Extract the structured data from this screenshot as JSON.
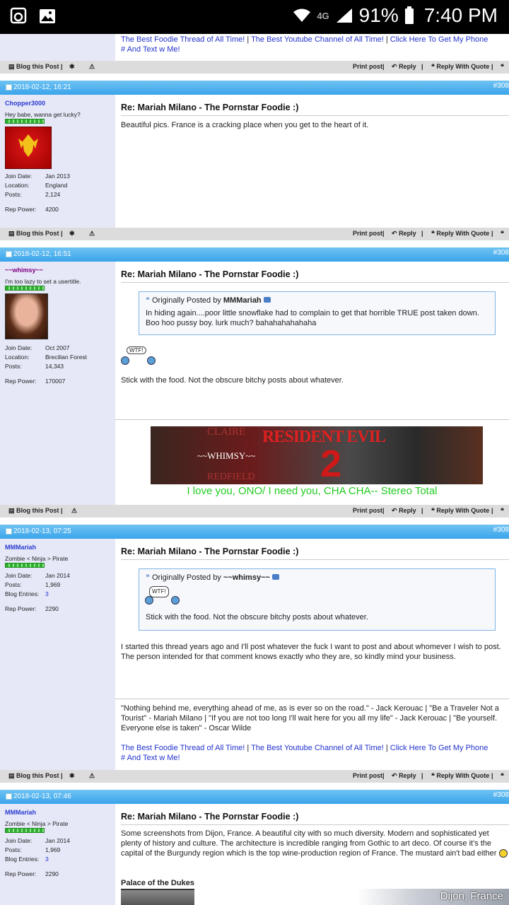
{
  "status_bar": {
    "time": "7:40 PM",
    "battery": "91%",
    "network": "4G"
  },
  "links": {
    "a": "The Best Foodie Thread of All Time!",
    "b": "The Best Youtube Channel of All Time!",
    "c": "Click Here To Get My Phone",
    "d": "# And Text w Me!",
    "sep": "|"
  },
  "controls": {
    "blog": "Blog this Post",
    "print": "Print post",
    "reply": "Reply",
    "reply_quote": "Reply With Quote",
    "sep": "|"
  },
  "post_title": "Re: Mariah Milano - The Pornstar Foodie :)",
  "labels": {
    "join": "Join Date:",
    "location": "Location:",
    "posts": "Posts:",
    "blog_entries": "Blog Entries:",
    "rep_power": "Rep Power:",
    "originally": "Originally Posted by"
  },
  "posts": [
    {
      "date": "2018-02-12, 16:21",
      "num": "#308",
      "user": "Chopper3000",
      "status": "Hey babe, wanna get lucky?",
      "join": "Jan 2013",
      "location": "England",
      "posts": "2,124",
      "rep": "4200",
      "text": "Beautiful pics. France is a cracking place when you get to the heart of it."
    },
    {
      "date": "2018-02-12, 16:51",
      "num": "#308",
      "user": "~~whimsy~~",
      "status": "I'm too lazy to set a usertitle.",
      "join": "Oct 2007",
      "location": "Brecilian Forest",
      "posts": "14,343",
      "rep": "170007",
      "quote_author": "MMMariah",
      "quote_text": "In hiding again....poor little snowflake had to complain to get that horrible TRUE post taken down. Boo hoo pussy boy. lurk much? bahahahahahaha",
      "wtf": "WTF!",
      "text": "Stick with the food. Not the obscure bitchy posts about whatever.",
      "banner_left_top": "CLAIRE",
      "banner_name": "~~WHIMSY~~",
      "banner_left_bottom": "REDFIELD",
      "banner_title": "RESIDENT EVIL",
      "banner_num": "2",
      "sig": "I love you, ONO/ I need you, CHA CHA-- Stereo Total"
    },
    {
      "date": "2018-02-13, 07:25",
      "num": "#308",
      "user": "MMMariah",
      "status": "Zombie < Ninja > Pirate",
      "join": "Jan 2014",
      "posts": "1,969",
      "blog_entries": "3",
      "rep": "2290",
      "quote_author": "~~whimsy~~",
      "wtf": "WTF!",
      "quote_text": "Stick with the food. Not the obscure bitchy posts about whatever.",
      "text": "I started this thread years ago and I'll post whatever the fuck I want to post and about whomever I wish to post. The person intended for that comment knows exactly who they are, so kindly mind your business.",
      "sig": "\"Nothing behind me, everything ahead of me, as is ever so on the road.\" - Jack Kerouac | \"Be a Traveler Not a Tourist\" - Mariah Milano | \"If you are not too long I'll wait here for you all my life\" - Jack Kerouac | \"Be yourself. Everyone else is taken\" - Oscar Wilde"
    },
    {
      "date": "2018-02-13, 07:46",
      "num": "#308",
      "user": "MMMariah",
      "status": "Zombie < Ninja > Pirate",
      "join": "Jan 2014",
      "posts": "1,969",
      "blog_entries": "3",
      "rep": "2290",
      "text": "Some screenshots from Dijon, France. A beautiful city with so much diversity. Modern and sophisticated yet plenty of history and culture. The architecture is incredible ranging from Gothic to art deco. Of course it's the capital of the Burgundy region which is the top wine-production region of France. The mustard ain't bad either",
      "subhead": "Palace of the Dukes",
      "photo_caption": "Dijon, France"
    }
  ],
  "colors": {
    "link": "#2233cc",
    "datebar": "#3aa4ea",
    "userpanel": "#e6e8f8",
    "sig_green": "#22cc22",
    "username": "#2a3ad0",
    "whimsy_name": "#800080"
  }
}
